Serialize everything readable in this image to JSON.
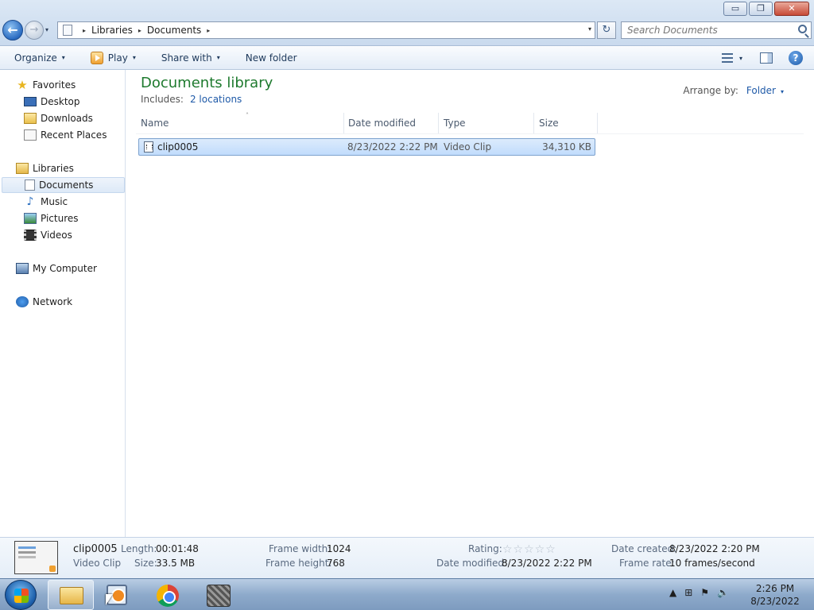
{
  "window": {
    "caption_buttons": {
      "minimize": "▭",
      "maximize": "❐",
      "close": "✕"
    }
  },
  "nav": {
    "back_glyph": "←",
    "forward_glyph": "→",
    "recent_drop_glyph": "▾"
  },
  "address": {
    "separator": "▸",
    "segments": [
      "Libraries",
      "Documents"
    ],
    "drop_glyph": "▾",
    "refresh_glyph": "↻"
  },
  "search": {
    "placeholder": "Search Documents"
  },
  "toolbar": {
    "organize": "Organize",
    "play": "Play",
    "share_with": "Share with",
    "new_folder": "New folder",
    "caret": "▾",
    "help_glyph": "?"
  },
  "sidebar": {
    "favorites": {
      "label": "Favorites",
      "items": [
        "Desktop",
        "Downloads",
        "Recent Places"
      ]
    },
    "libraries": {
      "label": "Libraries",
      "items": [
        "Documents",
        "Music",
        "Pictures",
        "Videos"
      ],
      "selected": "Documents"
    },
    "computer": "My Computer",
    "network": "Network",
    "icons": {
      "favorites": "star-icon",
      "music": "music-note-icon"
    },
    "star_glyph": "★",
    "music_glyph": "♪"
  },
  "library": {
    "title": "Documents library",
    "includes_label": "Includes:",
    "includes_link": "2 locations",
    "arrange_label": "Arrange by:",
    "arrange_value": "Folder"
  },
  "columns": {
    "headers": [
      "Name",
      "Date modified",
      "Type",
      "Size"
    ],
    "sort_glyph": "˄"
  },
  "files": [
    {
      "name": "clip0005",
      "date_modified": "8/23/2022 2:22 PM",
      "type": "Video Clip",
      "size": "34,310 KB"
    }
  ],
  "details": {
    "name": "clip0005",
    "type": "Video Clip",
    "length_label": "Length:",
    "length": "00:01:48",
    "size_label": "Size:",
    "size": "33.5 MB",
    "frame_width_label": "Frame width:",
    "frame_width": "1024",
    "frame_height_label": "Frame height:",
    "frame_height": "768",
    "rating_label": "Rating:",
    "rating_stars": "☆☆☆☆☆",
    "date_modified_label": "Date modified:",
    "date_modified": "8/23/2022 2:22 PM",
    "date_created_label": "Date created:",
    "date_created": "8/23/2022 2:20 PM",
    "frame_rate_label": "Frame rate:",
    "frame_rate": "10 frames/second"
  },
  "taskbar": {
    "tray_icons": [
      "▲",
      "⊞",
      "⚑",
      "🔈"
    ],
    "time": "2:26 PM",
    "date": "8/23/2022"
  },
  "colors": {
    "library_title": "#1e7a2e",
    "link": "#1f5aa8",
    "selection": "#c1dcfc"
  }
}
